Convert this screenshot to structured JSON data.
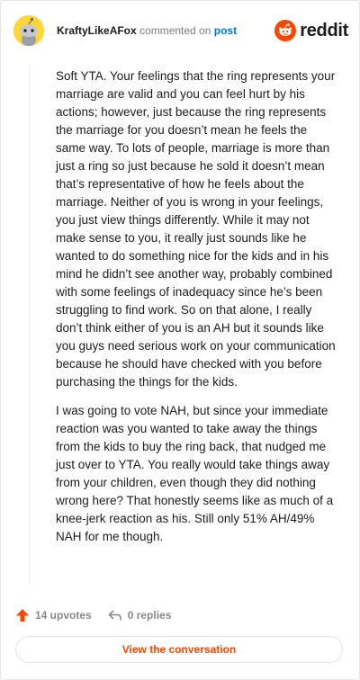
{
  "comment": {
    "username": "KraftyLikeAFox",
    "action_text": "commented on",
    "post_link": "post",
    "brand": "reddit",
    "paragraphs": [
      "Soft YTA. Your feelings that the ring represents your marriage are valid and you can feel hurt by his actions; however, just because the ring represents the marriage for you doesn’t mean he feels the same way. To lots of people, marriage is more than just a ring so just because he sold it doesn’t mean that’s representative of how he feels about the marriage. Neither of you is wrong in your feelings, you just view things differently. While it may not make sense to you, it really just sounds like he wanted to do something nice for the kids and in his mind he didn’t see another way, probably combined with some feelings of inadequacy since he’s been struggling to find work. So on that alone, I really don’t think either of you is an AH but it sounds like you guys need serious work on your communication because he should have checked with you before purchasing the things for the kids.",
      "I was going to vote NAH, but since your immediate reaction was you wanted to take away the things from the kids to buy the ring back, that nudged me just over to YTA. You really would take things away from your children, even though they did nothing wrong here? That honestly seems like as much of a knee-jerk reaction as his. Still only 51% AH/49% NAH for me though."
    ],
    "upvotes_label": "14 upvotes",
    "replies_label": "0 replies",
    "view_button": "View the conversation"
  },
  "icons": {
    "avatar": "snoo-avatar",
    "logo": "reddit-alien-icon",
    "upvote": "upvote-arrow-icon",
    "reply": "reply-icon"
  },
  "colors": {
    "accent": "#ff4500",
    "link": "#0079d3",
    "avatar_bg": "#ffd635",
    "muted": "#878a8c"
  }
}
